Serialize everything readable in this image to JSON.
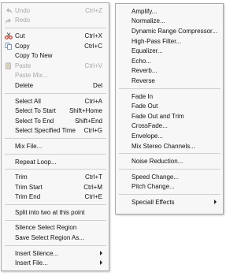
{
  "left_menu": {
    "items": [
      {
        "label": "Undo",
        "shortcut": "Ctrl+Z",
        "disabled": true,
        "icon": "undo-icon"
      },
      {
        "label": "Redo",
        "shortcut": "",
        "disabled": true,
        "icon": "redo-icon"
      },
      {
        "sep": true
      },
      {
        "label": "Cut",
        "shortcut": "Ctrl+X",
        "icon": "cut-icon"
      },
      {
        "label": "Copy",
        "shortcut": "Ctrl+C",
        "icon": "copy-icon"
      },
      {
        "label": "Copy To New",
        "shortcut": ""
      },
      {
        "label": "Paste",
        "shortcut": "Ctrl+V",
        "disabled": true,
        "icon": "paste-icon"
      },
      {
        "label": "Paste Mix...",
        "shortcut": "",
        "disabled": true
      },
      {
        "label": "Delete",
        "shortcut": "Del"
      },
      {
        "sep": true
      },
      {
        "label": "Select All",
        "shortcut": "Ctrl+A"
      },
      {
        "label": "Select To Start",
        "shortcut": "Shift+Home"
      },
      {
        "label": "Select To End",
        "shortcut": "Shift+End"
      },
      {
        "label": "Select Specified Time",
        "shortcut": "Ctrl+G"
      },
      {
        "sep": true
      },
      {
        "label": "Mix File...",
        "shortcut": ""
      },
      {
        "sep": true
      },
      {
        "label": "Repeat Loop...",
        "shortcut": ""
      },
      {
        "sep": true
      },
      {
        "label": "Trim",
        "shortcut": "Ctrl+T"
      },
      {
        "label": "Trim Start",
        "shortcut": "Ctrl+M"
      },
      {
        "label": "Trim End",
        "shortcut": "Ctrl+E"
      },
      {
        "sep": true
      },
      {
        "label": "Split into two at this point",
        "shortcut": ""
      },
      {
        "sep": true
      },
      {
        "label": "Silence Select Region",
        "shortcut": ""
      },
      {
        "label": "Save Select Region As...",
        "shortcut": ""
      },
      {
        "sep": true
      },
      {
        "label": "Insert Silence...",
        "shortcut": "",
        "submenu": true
      },
      {
        "label": "Insert File...",
        "shortcut": "",
        "submenu": true
      }
    ]
  },
  "right_menu": {
    "items": [
      {
        "label": "Amplify..."
      },
      {
        "label": "Normalize..."
      },
      {
        "label": "Dynamic Range Compressor..."
      },
      {
        "label": "High-Pass Filter..."
      },
      {
        "label": "Equalizer..."
      },
      {
        "label": "Echo..."
      },
      {
        "label": "Reverb..."
      },
      {
        "label": "Reverse"
      },
      {
        "sep": true
      },
      {
        "label": "Fade In"
      },
      {
        "label": "Fade Out"
      },
      {
        "label": "Fade Out and Trim"
      },
      {
        "label": "CrossFade..."
      },
      {
        "label": "Envelope..."
      },
      {
        "label": "Mix Stereo Channels..."
      },
      {
        "sep": true
      },
      {
        "label": "Noise Reduction..."
      },
      {
        "sep": true
      },
      {
        "label": "Speed Change..."
      },
      {
        "label": "Pitch Change..."
      },
      {
        "sep": true
      },
      {
        "label": "Speciall Effects",
        "submenu": true
      }
    ]
  },
  "colors": {
    "menu_bg": "#f7f7f7",
    "disabled_text": "#a8a8a8",
    "separator": "#cfcfcf"
  }
}
